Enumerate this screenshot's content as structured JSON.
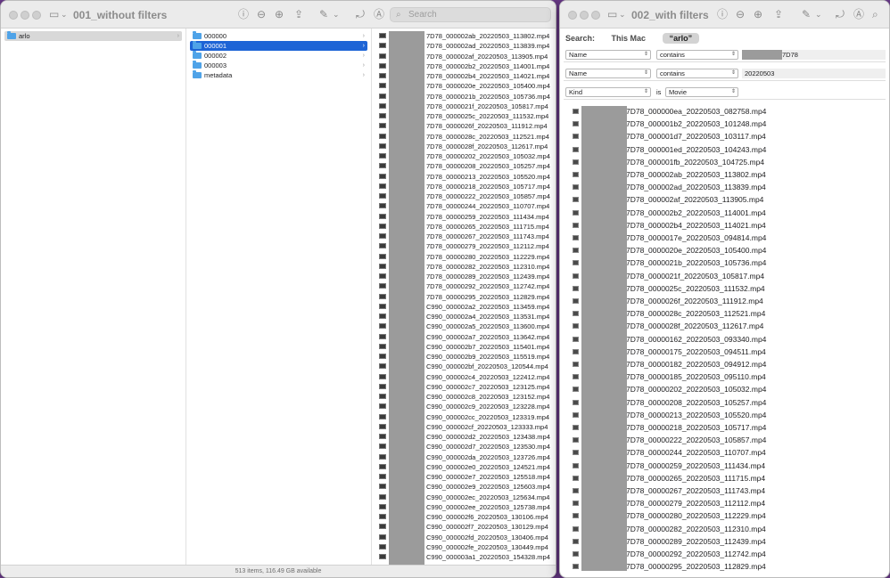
{
  "window_left": {
    "title": "001_without filters",
    "search_placeholder": "Search",
    "col1_items": [
      {
        "label": "arlo",
        "selected": true
      }
    ],
    "col2_items": [
      {
        "label": "000000",
        "active": false
      },
      {
        "label": "000001",
        "active": true
      },
      {
        "label": "000002",
        "active": false
      },
      {
        "label": "000003",
        "active": false
      },
      {
        "label": "metadata",
        "active": false
      }
    ],
    "files": [
      "7D78_000002ab_20220503_113802.mp4",
      "7D78_000002ad_20220503_113839.mp4",
      "7D78_000002af_20220503_113905.mp4",
      "7D78_000002b2_20220503_114001.mp4",
      "7D78_000002b4_20220503_114021.mp4",
      "7D78_0000020e_20220503_105400.mp4",
      "7D78_0000021b_20220503_105736.mp4",
      "7D78_0000021f_20220503_105817.mp4",
      "7D78_0000025c_20220503_111532.mp4",
      "7D78_0000026f_20220503_111912.mp4",
      "7D78_0000028c_20220503_112521.mp4",
      "7D78_0000028f_20220503_112617.mp4",
      "7D78_00000202_20220503_105032.mp4",
      "7D78_00000208_20220503_105257.mp4",
      "7D78_00000213_20220503_105520.mp4",
      "7D78_00000218_20220503_105717.mp4",
      "7D78_00000222_20220503_105857.mp4",
      "7D78_00000244_20220503_110707.mp4",
      "7D78_00000259_20220503_111434.mp4",
      "7D78_00000265_20220503_111715.mp4",
      "7D78_00000267_20220503_111743.mp4",
      "7D78_00000279_20220503_112112.mp4",
      "7D78_00000280_20220503_112229.mp4",
      "7D78_00000282_20220503_112310.mp4",
      "7D78_00000289_20220503_112439.mp4",
      "7D78_00000292_20220503_112742.mp4",
      "7D78_00000295_20220503_112829.mp4",
      "C990_000002a2_20220503_113459.mp4",
      "C990_000002a4_20220503_113531.mp4",
      "C990_000002a5_20220503_113600.mp4",
      "C990_000002a7_20220503_113642.mp4",
      "C990_000002b7_20220503_115401.mp4",
      "C990_000002b9_20220503_115519.mp4",
      "C990_000002bf_20220503_120544.mp4",
      "C990_000002c4_20220503_122412.mp4",
      "C990_000002c7_20220503_123125.mp4",
      "C990_000002c8_20220503_123152.mp4",
      "C990_000002c9_20220503_123228.mp4",
      "C990_000002cc_20220503_123319.mp4",
      "C990_000002cf_20220503_123333.mp4",
      "C990_000002d2_20220503_123438.mp4",
      "C990_000002d7_20220503_123530.mp4",
      "C990_000002da_20220503_123726.mp4",
      "C990_000002e0_20220503_124521.mp4",
      "C990_000002e7_20220503_125518.mp4",
      "C990_000002e9_20220503_125603.mp4",
      "C990_000002ec_20220503_125634.mp4",
      "C990_000002ee_20220503_125738.mp4",
      "C990_000002f6_20220503_130106.mp4",
      "C990_000002f7_20220503_130129.mp4",
      "C990_000002fd_20220503_130406.mp4",
      "C990_000002fe_20220503_130449.mp4",
      "C990_000003a1_20220503_154328.mp4"
    ],
    "status": "513 items, 116.49 GB available"
  },
  "window_right": {
    "title": "002_with filters",
    "search_label": "Search:",
    "scope_this_mac": "This Mac",
    "scope_arlo": "“arlo”",
    "criteria": [
      {
        "attr": "Name",
        "op": "contains",
        "value": "7D78"
      },
      {
        "attr": "Name",
        "op": "contains",
        "value": "20220503"
      },
      {
        "attr": "Kind",
        "op": "is",
        "value": "Movie"
      }
    ],
    "results": [
      "7D78_000000ea_20220503_082758.mp4",
      "7D78_000001b2_20220503_101248.mp4",
      "7D78_000001d7_20220503_103117.mp4",
      "7D78_000001ed_20220503_104243.mp4",
      "7D78_000001fb_20220503_104725.mp4",
      "7D78_000002ab_20220503_113802.mp4",
      "7D78_000002ad_20220503_113839.mp4",
      "7D78_000002af_20220503_113905.mp4",
      "7D78_000002b2_20220503_114001.mp4",
      "7D78_000002b4_20220503_114021.mp4",
      "7D78_0000017e_20220503_094814.mp4",
      "7D78_0000020e_20220503_105400.mp4",
      "7D78_0000021b_20220503_105736.mp4",
      "7D78_0000021f_20220503_105817.mp4",
      "7D78_0000025c_20220503_111532.mp4",
      "7D78_0000026f_20220503_111912.mp4",
      "7D78_0000028c_20220503_112521.mp4",
      "7D78_0000028f_20220503_112617.mp4",
      "7D78_00000162_20220503_093340.mp4",
      "7D78_00000175_20220503_094511.mp4",
      "7D78_00000182_20220503_094912.mp4",
      "7D78_00000185_20220503_095110.mp4",
      "7D78_00000202_20220503_105032.mp4",
      "7D78_00000208_20220503_105257.mp4",
      "7D78_00000213_20220503_105520.mp4",
      "7D78_00000218_20220503_105717.mp4",
      "7D78_00000222_20220503_105857.mp4",
      "7D78_00000244_20220503_110707.mp4",
      "7D78_00000259_20220503_111434.mp4",
      "7D78_00000265_20220503_111715.mp4",
      "7D78_00000267_20220503_111743.mp4",
      "7D78_00000279_20220503_112112.mp4",
      "7D78_00000280_20220503_112229.mp4",
      "7D78_00000282_20220503_112310.mp4",
      "7D78_00000289_20220503_112439.mp4",
      "7D78_00000292_20220503_112742.mp4",
      "7D78_00000295_20220503_112829.mp4"
    ]
  },
  "colors": {
    "accent": "#1d64d6",
    "folder": "#4fa3e8",
    "desktop": "#6a3a8a"
  }
}
